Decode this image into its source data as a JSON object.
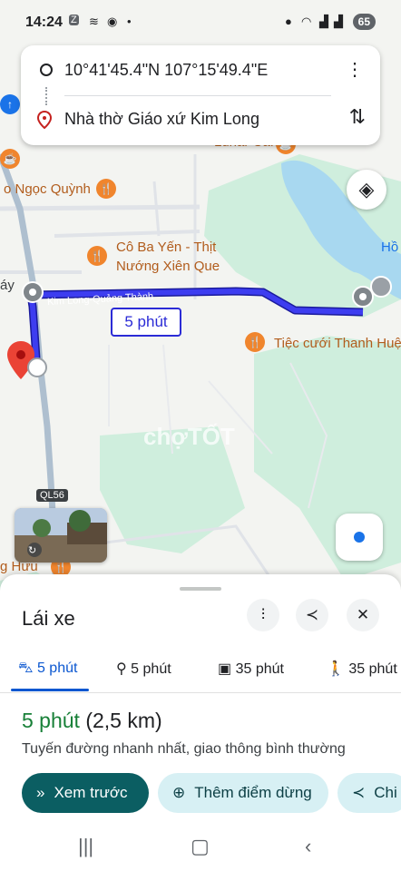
{
  "status_bar": {
    "time": "14:24",
    "icons": [
      "zalo-icon",
      "activity-icon",
      "shield-icon",
      "dot-icon"
    ],
    "right_icons": [
      "location-icon",
      "wifi-icon",
      "signal-icon",
      "signal-icon"
    ],
    "battery": "65"
  },
  "search": {
    "origin": "10°41'45.4\"N 107°15'49.4\"E",
    "destination": "Nhà thờ Giáo xứ Kim Long"
  },
  "map": {
    "labels": {
      "ngoc_quynh": "o Ngọc Quỳnh",
      "co_ba_yen": "Cô Ba Yến - Thịt",
      "co_ba_yen_2": "Nướng Xiên Que",
      "lunar_cafe": "Lunar Cafe",
      "tiec_cuoi": "Tiệc cưới Thanh Huệ",
      "ho": "Hồ",
      "may": "áy",
      "vuu": "g Hữu",
      "road": "Kim Long-Quảng Thành",
      "highway": "QL56",
      "watermark": "chợTỐT"
    },
    "eta_chip": "5 phút",
    "route_color": "#2b2bd6"
  },
  "sheet": {
    "title": "Lái xe",
    "modes": [
      {
        "icon": "car-icon",
        "label": "5 phút",
        "active": true
      },
      {
        "icon": "motorbike-icon",
        "label": "5 phút",
        "active": false
      },
      {
        "icon": "transit-icon",
        "label": "35 phút",
        "active": false
      },
      {
        "icon": "walk-icon",
        "label": "35 phút",
        "active": false
      }
    ],
    "summary_time": "5 phút",
    "summary_distance": "(2,5 km)",
    "description": "Tuyến đường nhanh nhất, giao thông bình thường",
    "actions": {
      "preview": "Xem trước",
      "add_stop": "Thêm điểm dừng",
      "share_partial": "Chi"
    }
  },
  "colors": {
    "accent": "#0b57d0",
    "eta_green": "#188038",
    "primary_button": "#0b5e62",
    "secondary_button": "#d7f0f4"
  }
}
